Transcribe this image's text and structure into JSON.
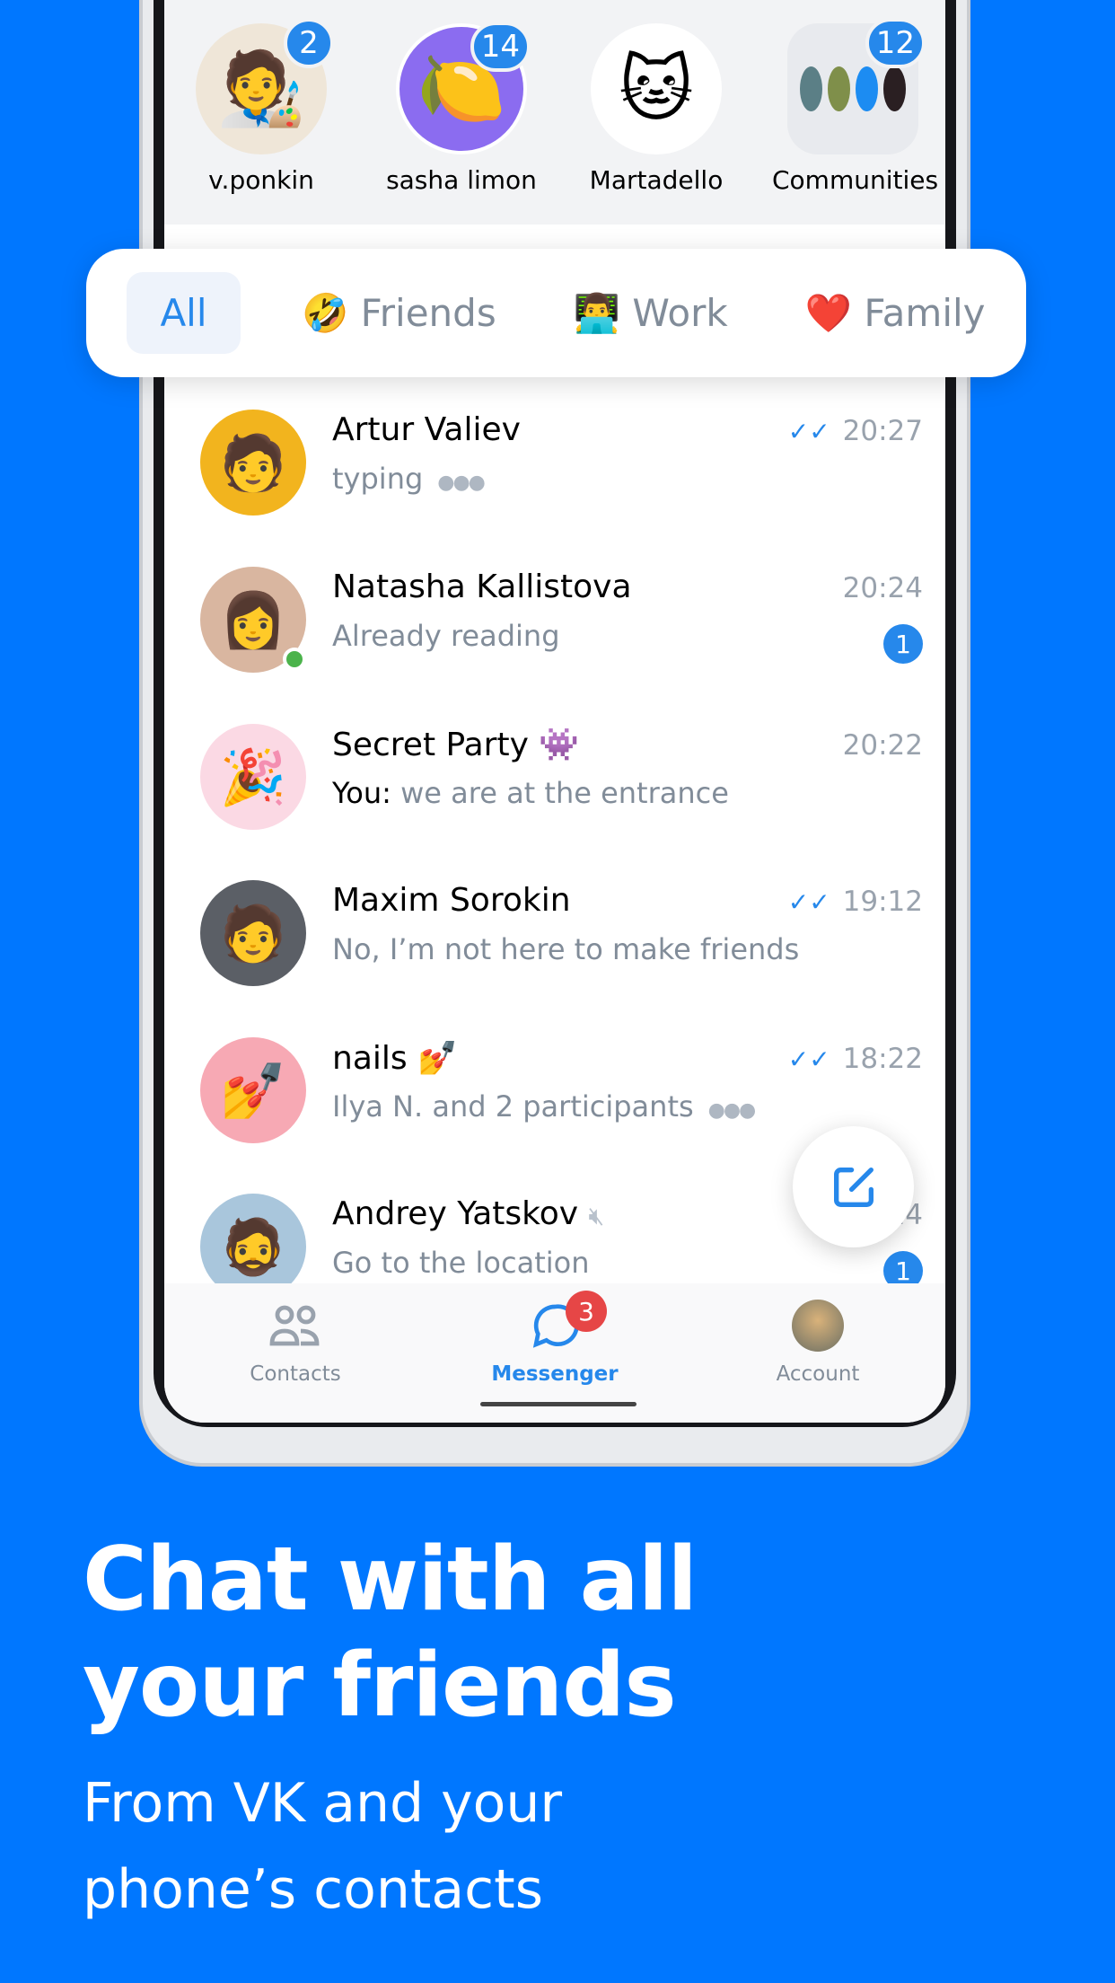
{
  "stories": [
    {
      "name": "v.ponkin",
      "badge": "2",
      "emoji": "🧑‍🎨"
    },
    {
      "name": "sasha limon",
      "badge": "14",
      "emoji": "🍋"
    },
    {
      "name": "Martadello",
      "badge": null,
      "emoji": "🐱"
    },
    {
      "name": "Communities",
      "badge": "12"
    }
  ],
  "filters": [
    {
      "emoji": "",
      "label": "All",
      "active": true
    },
    {
      "emoji": "🤣",
      "label": "Friends"
    },
    {
      "emoji": "👨‍💻",
      "label": "Work"
    },
    {
      "emoji": "❤️",
      "label": "Family"
    }
  ],
  "chats": [
    {
      "name": "Artur Valiev",
      "preview": "typing",
      "time": "20:27",
      "read": true,
      "typing": true
    },
    {
      "name": "Natasha Kallistova",
      "preview": "Already reading",
      "time": "20:24",
      "unread": "1",
      "online": true
    },
    {
      "name": "Secret Party 👾",
      "sender": "You:",
      "preview": "we are at the entrance",
      "time": "20:22"
    },
    {
      "name": "Maxim Sorokin",
      "preview": "No, I’m not here to make friends",
      "time": "19:12",
      "read": true
    },
    {
      "name": "nails 💅",
      "preview": "Ilya N. and 2 participants",
      "time": "18:22",
      "read": true,
      "typing": true
    },
    {
      "name": "Andrey Yatskov",
      "preview": "Go to the location",
      "time": "18:14",
      "unread": "1",
      "muted": true
    }
  ],
  "tabbar": {
    "contacts": "Contacts",
    "messenger": "Messenger",
    "messenger_badge": "3",
    "account": "Account"
  },
  "promo": {
    "headline_1": "Chat with all",
    "headline_2": "your friends",
    "sub_1": "From VK and your",
    "sub_2": "phone’s contacts"
  },
  "colors": {
    "background": "#0077FF",
    "accent": "#2688EB",
    "badge_red": "#E64646",
    "online": "#4BB34B"
  }
}
